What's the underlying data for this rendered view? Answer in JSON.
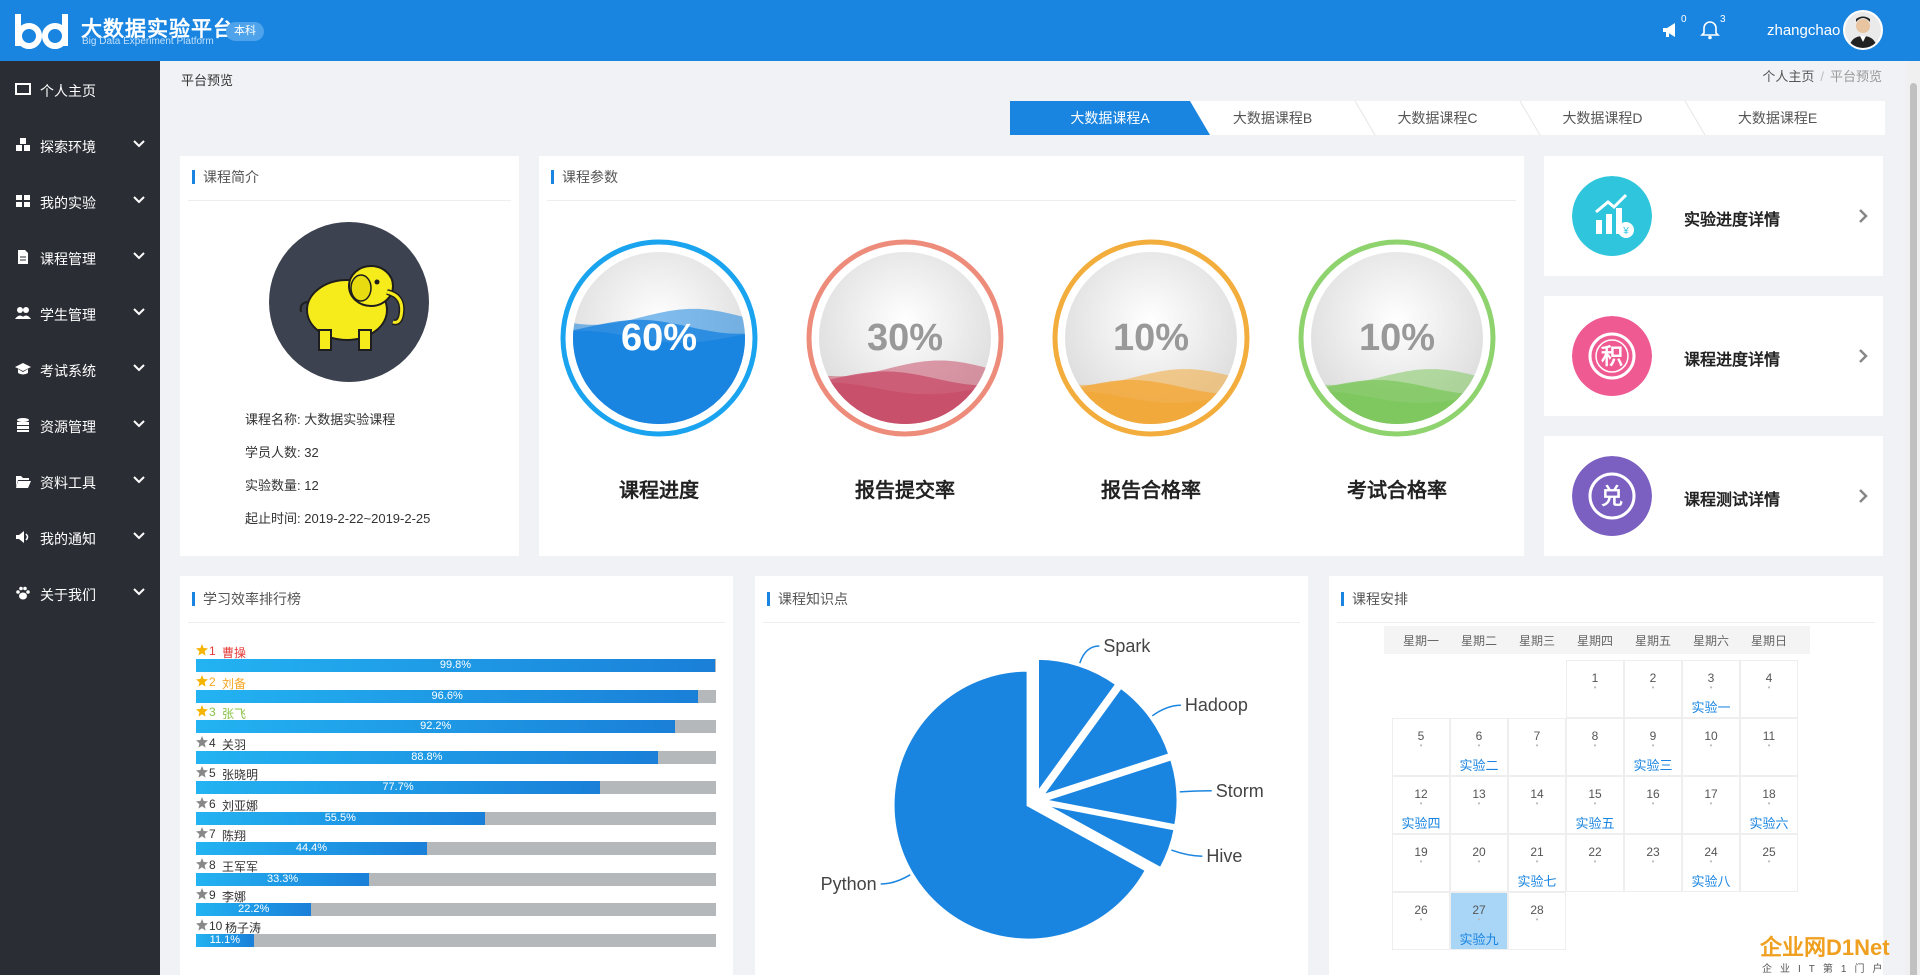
{
  "header": {
    "logo_title": "大数据实验平台",
    "logo_sub": "Big Data Experiment Platform",
    "level_badge": "本科",
    "announce_count": "0",
    "bell_count": "3",
    "username": "zhangchao",
    "brand_color": "#1a85e0"
  },
  "sidebar": {
    "bg_color": "#2a2d34",
    "items": [
      {
        "label": "个人主页",
        "icon": "id-card-icon",
        "expandable": false
      },
      {
        "label": "探索环境",
        "icon": "cubes-icon",
        "expandable": true
      },
      {
        "label": "我的实验",
        "icon": "grid-icon",
        "expandable": true
      },
      {
        "label": "课程管理",
        "icon": "file-icon",
        "expandable": true
      },
      {
        "label": "学生管理",
        "icon": "users-icon",
        "expandable": true
      },
      {
        "label": "考试系统",
        "icon": "graduation-cap-icon",
        "expandable": true
      },
      {
        "label": "资源管理",
        "icon": "database-icon",
        "expandable": true
      },
      {
        "label": "资料工具",
        "icon": "folder-open-icon",
        "expandable": true
      },
      {
        "label": "我的通知",
        "icon": "volume-icon",
        "expandable": true
      },
      {
        "label": "关于我们",
        "icon": "paw-icon",
        "expandable": true
      }
    ]
  },
  "page": {
    "title": "平台预览",
    "breadcrumb": [
      "个人主页",
      "平台预览"
    ]
  },
  "tabs": {
    "active_index": 0,
    "items": [
      "大数据课程A",
      "大数据课程B",
      "大数据课程C",
      "大数据课程D",
      "大数据课程E"
    ]
  },
  "course_intro": {
    "title": "课程简介",
    "rows": [
      {
        "label": "课程名称:",
        "value": "大数据实验课程"
      },
      {
        "label": "学员人数:",
        "value": "32"
      },
      {
        "label": "实验数量:",
        "value": "12"
      },
      {
        "label": "起止时间:",
        "value": "2019-2-22~2019-2-25"
      }
    ]
  },
  "course_params": {
    "title": "课程参数",
    "gauges": [
      {
        "label": "课程进度",
        "value": 60,
        "text": "60%",
        "ring": "#1aa3ee",
        "wave": "#1a85e0",
        "text_color": "#ffffff"
      },
      {
        "label": "报告提交率",
        "value": 30,
        "text": "30%",
        "ring": "#ee8c7b",
        "wave": "#c9506b",
        "text_color": "#999999"
      },
      {
        "label": "报告合格率",
        "value": 10,
        "text": "10%",
        "ring": "#f2ad3d",
        "wave": "#f2a93b",
        "text_color": "#999999"
      },
      {
        "label": "考试合格率",
        "value": 10,
        "text": "10%",
        "ring": "#8ed36e",
        "wave": "#7fc860",
        "text_color": "#999999"
      }
    ]
  },
  "details": [
    {
      "label": "实验进度详情",
      "icon": "chart-growth-icon",
      "color": "#2ec5dd"
    },
    {
      "label": "课程进度详情",
      "icon": "points-icon",
      "color": "#ef5a93"
    },
    {
      "label": "课程测试详情",
      "icon": "exchange-icon",
      "color": "#7b60c2"
    }
  ],
  "ranking": {
    "title": "学习效率排行榜",
    "items": [
      {
        "rank": "1",
        "name": "曹操",
        "value": 99.8,
        "text": "99.8%",
        "color": "#e53935",
        "star": "gold"
      },
      {
        "rank": "2",
        "name": "刘备",
        "value": 96.6,
        "text": "96.6%",
        "color": "#f5a623",
        "star": "gold"
      },
      {
        "rank": "3",
        "name": "张飞",
        "value": 92.2,
        "text": "92.2%",
        "color": "#8bc34a",
        "star": "gold"
      },
      {
        "rank": "4",
        "name": "关羽",
        "value": 88.8,
        "text": "88.8%",
        "color": "#333333",
        "star": "gray"
      },
      {
        "rank": "5",
        "name": "张晓明",
        "value": 77.7,
        "text": "77.7%",
        "color": "#333333",
        "star": "gray"
      },
      {
        "rank": "6",
        "name": "刘亚娜",
        "value": 55.5,
        "text": "55.5%",
        "color": "#333333",
        "star": "gray"
      },
      {
        "rank": "7",
        "name": "陈翔",
        "value": 44.4,
        "text": "44.4%",
        "color": "#333333",
        "star": "gray"
      },
      {
        "rank": "8",
        "name": "王军军",
        "value": 33.3,
        "text": "33.3%",
        "color": "#333333",
        "star": "gray"
      },
      {
        "rank": "9",
        "name": "李娜",
        "value": 22.2,
        "text": "22.2%",
        "color": "#333333",
        "star": "gray"
      },
      {
        "rank": "10",
        "name": "杨子涛",
        "value": 11.1,
        "text": "11.1%",
        "color": "#333333",
        "star": "gray"
      }
    ]
  },
  "knowledge": {
    "title": "课程知识点"
  },
  "chart_data": {
    "type": "pie",
    "categories": [
      "Spark",
      "Hadoop",
      "Storm",
      "Hive",
      "Python"
    ],
    "values": [
      10,
      10,
      8,
      5,
      67
    ],
    "exploded": true,
    "color": "#1a85e0",
    "title": ""
  },
  "schedule": {
    "title": "课程安排",
    "weekdays": [
      "星期一",
      "星期二",
      "星期三",
      "星期四",
      "星期五",
      "星期六",
      "星期日"
    ],
    "weeks": [
      [
        null,
        null,
        null,
        {
          "d": "1"
        },
        {
          "d": "2"
        },
        {
          "d": "3",
          "ev": "实验一"
        },
        {
          "d": "4"
        }
      ],
      [
        {
          "d": "5"
        },
        {
          "d": "6",
          "ev": "实验二"
        },
        {
          "d": "7"
        },
        {
          "d": "8"
        },
        {
          "d": "9",
          "ev": "实验三"
        },
        {
          "d": "10"
        },
        {
          "d": "11"
        }
      ],
      [
        {
          "d": "12",
          "ev": "实验四"
        },
        {
          "d": "13"
        },
        {
          "d": "14"
        },
        {
          "d": "15",
          "ev": "实验五"
        },
        {
          "d": "16"
        },
        {
          "d": "17"
        },
        {
          "d": "18",
          "ev": "实验六"
        }
      ],
      [
        {
          "d": "19"
        },
        {
          "d": "20"
        },
        {
          "d": "21",
          "ev": "实验七"
        },
        {
          "d": "22"
        },
        {
          "d": "23"
        },
        {
          "d": "24",
          "ev": "实验八"
        },
        {
          "d": "25"
        }
      ],
      [
        {
          "d": "26"
        },
        {
          "d": "27",
          "ev": "实验九",
          "today": true
        },
        {
          "d": "28"
        },
        null,
        null,
        null,
        null
      ]
    ]
  },
  "watermark": {
    "text": "企业网D1Net",
    "sub": "企业IT第1门户"
  }
}
